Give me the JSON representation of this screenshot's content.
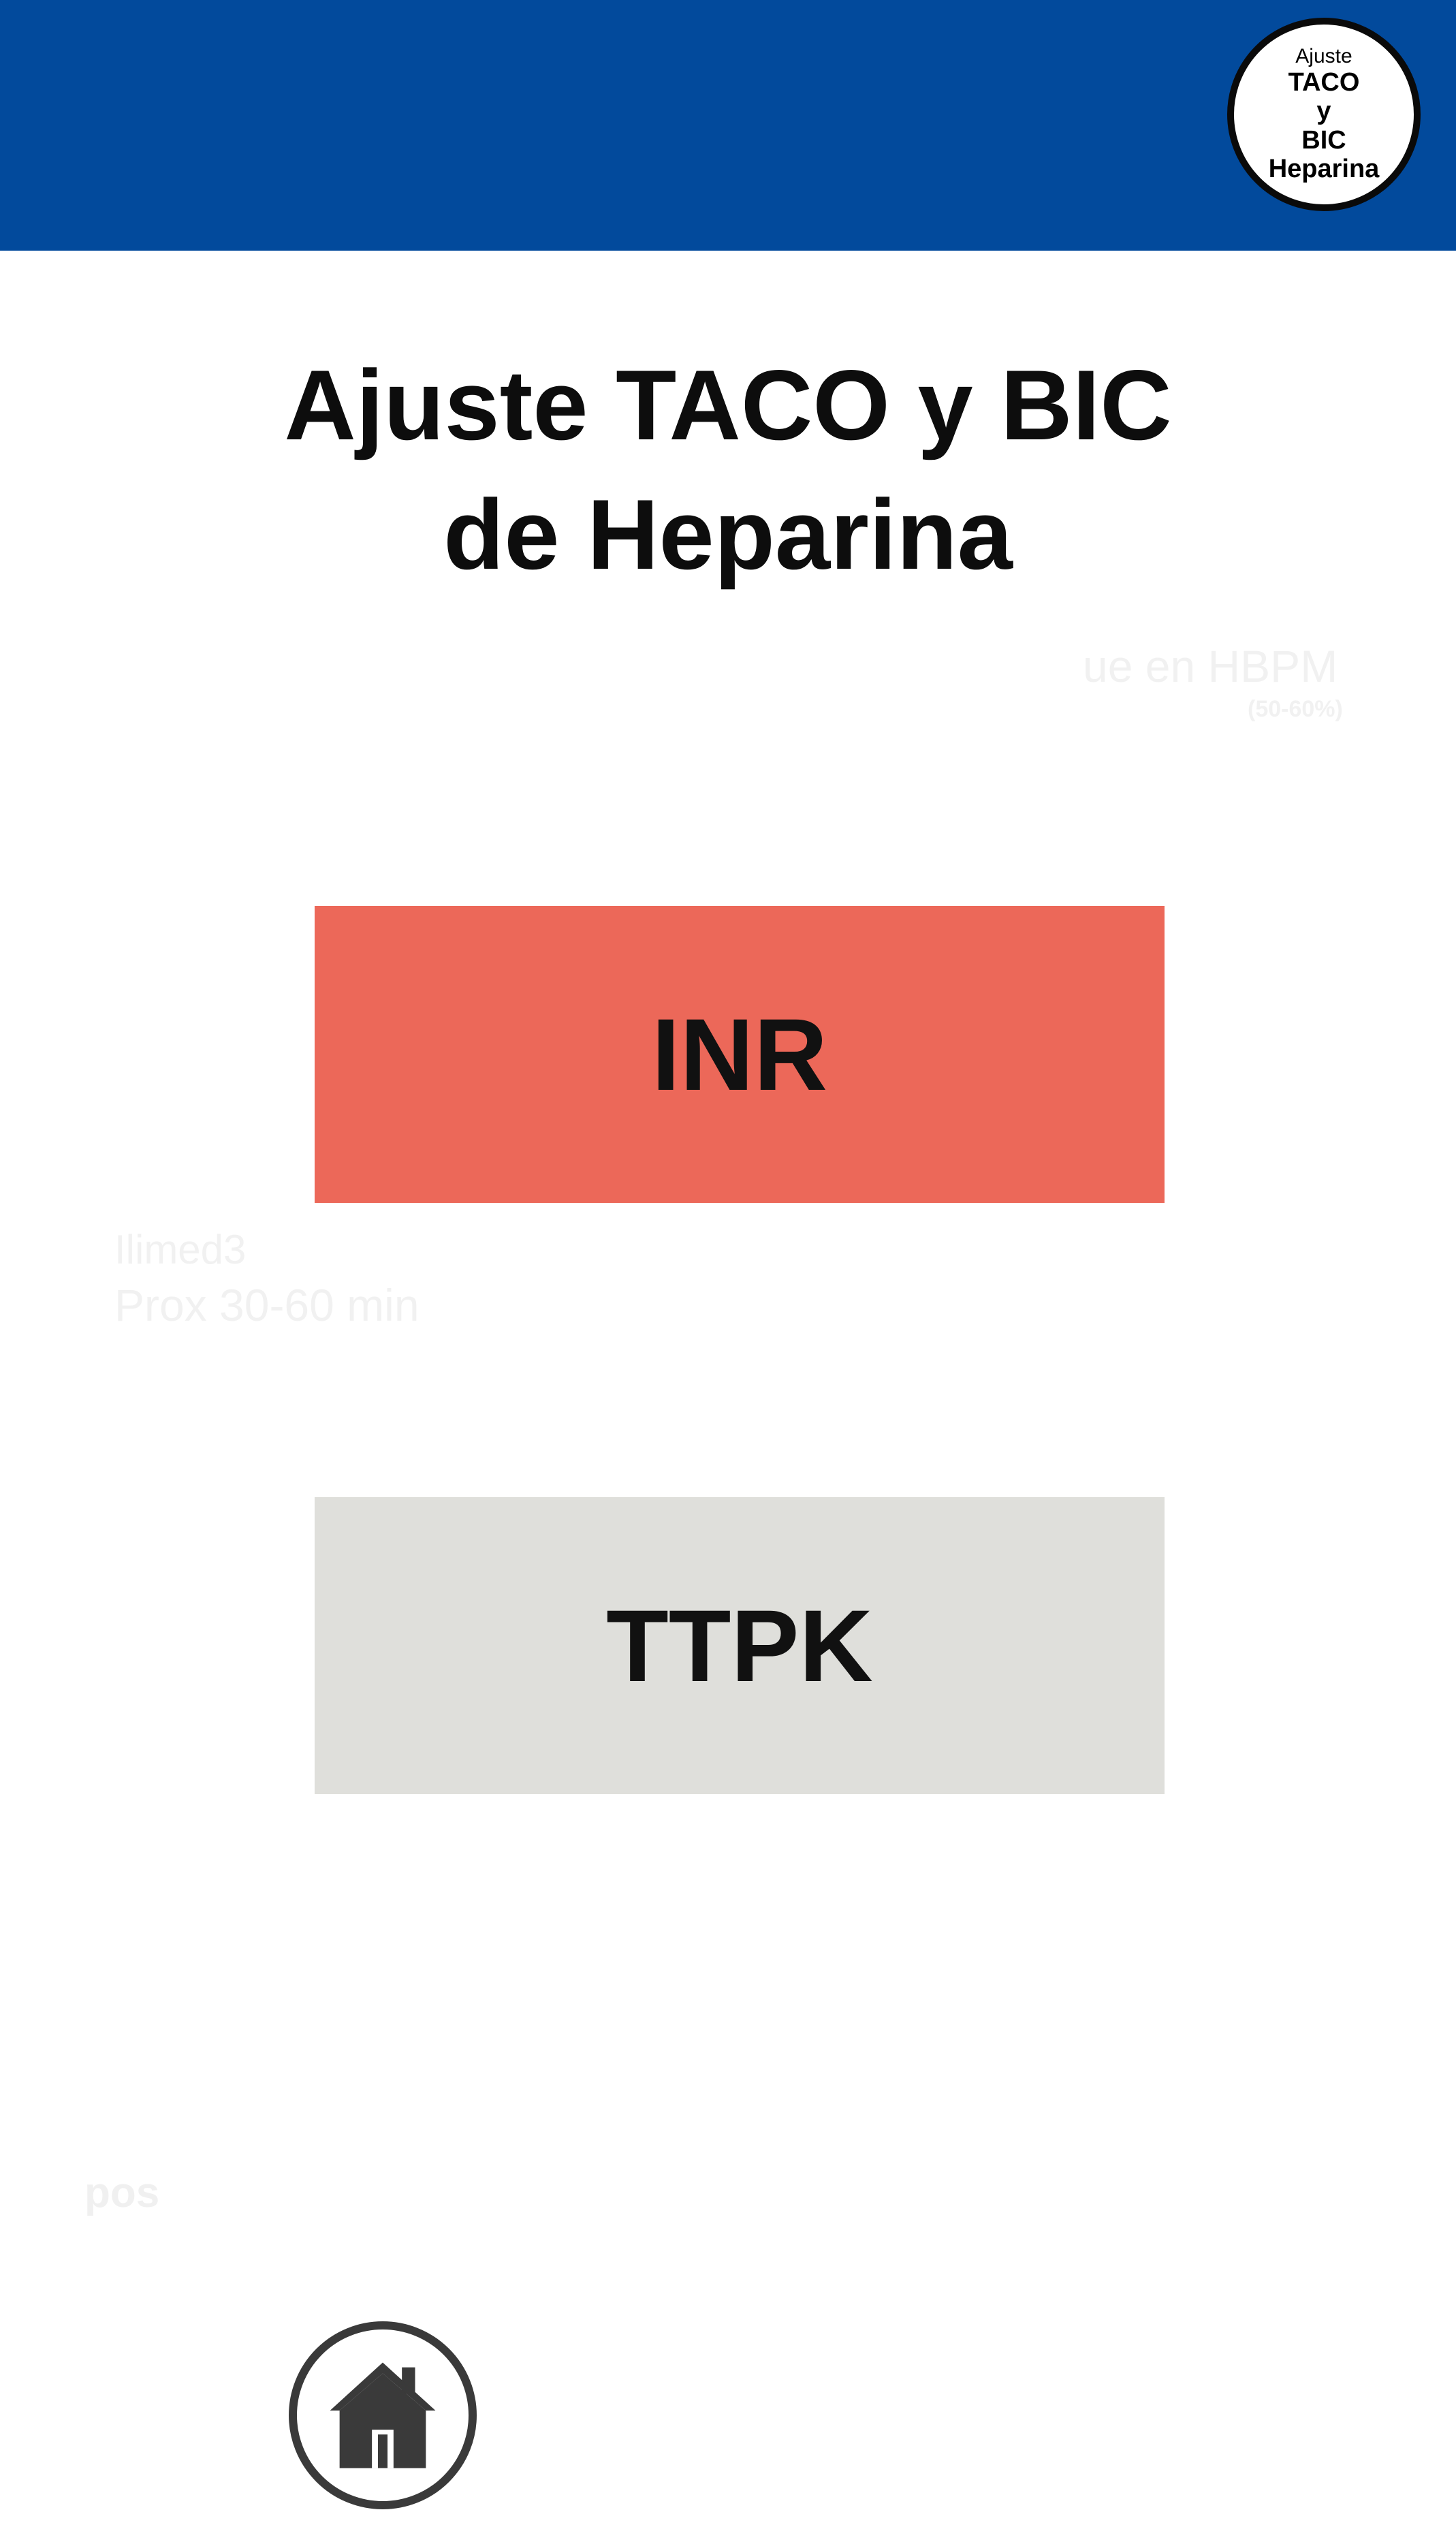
{
  "header": {
    "background_color": "#024a9c",
    "logo": {
      "line1": "Ajuste",
      "line2": "TACO",
      "line3": "y",
      "line4": "BIC",
      "line5": "Heparina"
    }
  },
  "main": {
    "title_line1": "Ajuste TACO y BIC",
    "title_line2": "de Heparina",
    "buttons": [
      {
        "label": "INR",
        "color": "#ec6859"
      },
      {
        "label": "TTPK",
        "color": "#dfdfdb"
      }
    ]
  },
  "background_ghost_text": {
    "t1": "ue en HBPM",
    "t2": "(50-60%)",
    "t3": "Ilimed3",
    "t4": "Prox 30-60 min",
    "t5": "pos"
  },
  "footer": {
    "home_icon": "home-icon"
  }
}
